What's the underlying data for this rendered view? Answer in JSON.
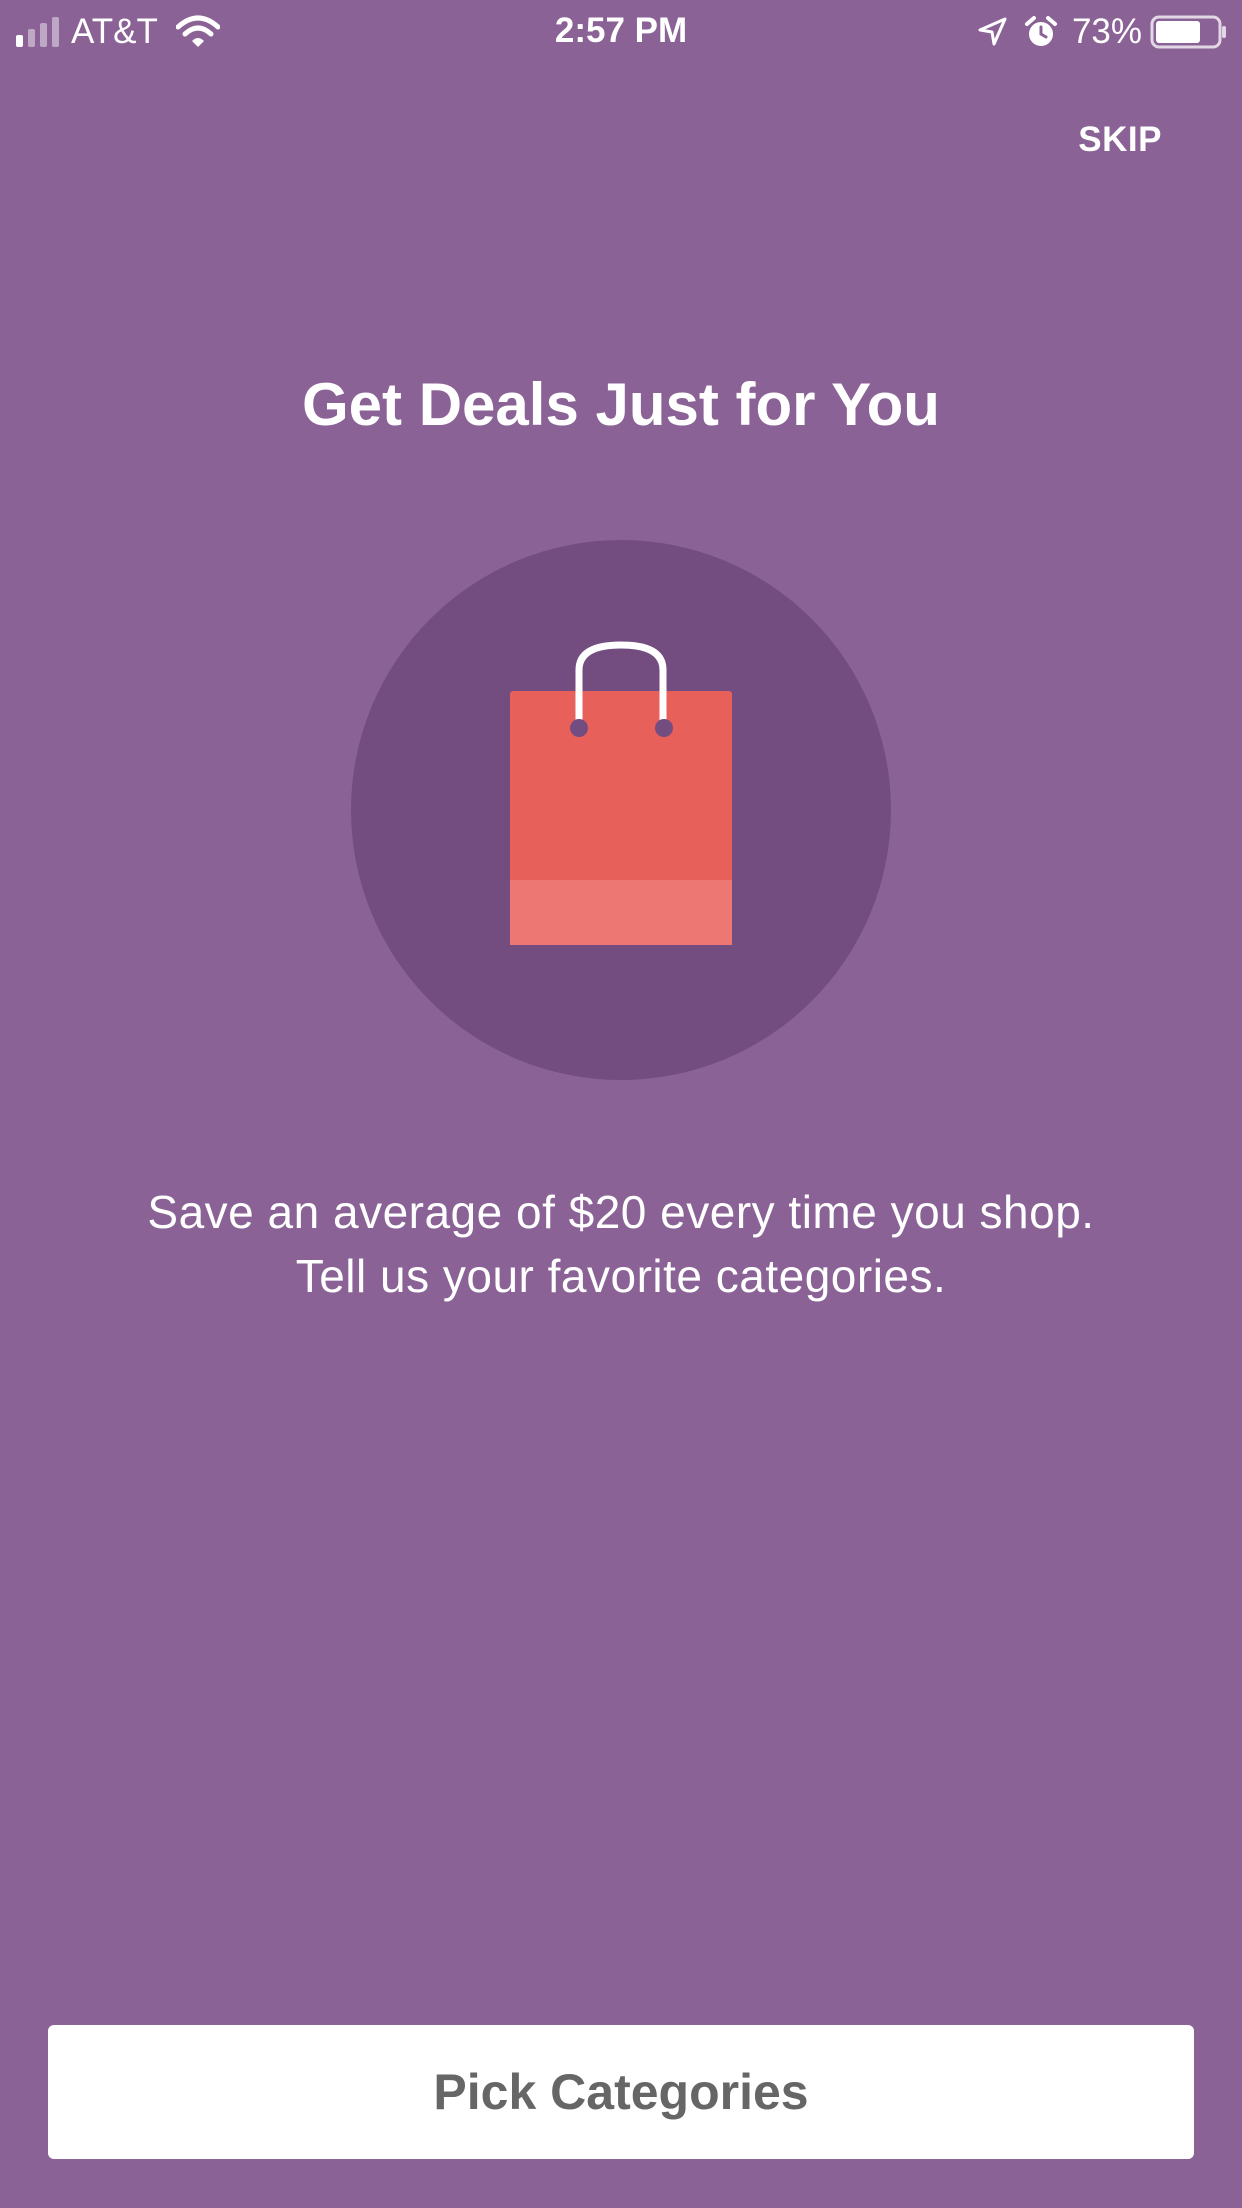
{
  "status_bar": {
    "carrier": "AT&T",
    "time": "2:57 PM",
    "battery_percent": "73%",
    "battery_level": 0.73,
    "signal_bars_active": 1,
    "signal_bars_total": 4,
    "icons": [
      "signal-icon",
      "wifi-icon",
      "location-arrow-icon",
      "alarm-icon",
      "battery-icon"
    ]
  },
  "header": {
    "skip_label": "SKIP"
  },
  "main": {
    "title": "Get Deals Just for You",
    "hero_icon": "shopping-bag-icon",
    "subtitle_line1": "Save an average of $20 every time you shop.",
    "subtitle_line2": "Tell us your favorite categories."
  },
  "footer": {
    "cta_label": "Pick Categories"
  },
  "colors": {
    "background": "#8A6296",
    "circle": "#744D80",
    "bag": "#E8605A",
    "bag_band": "#EC7773",
    "button_text": "#666666"
  }
}
